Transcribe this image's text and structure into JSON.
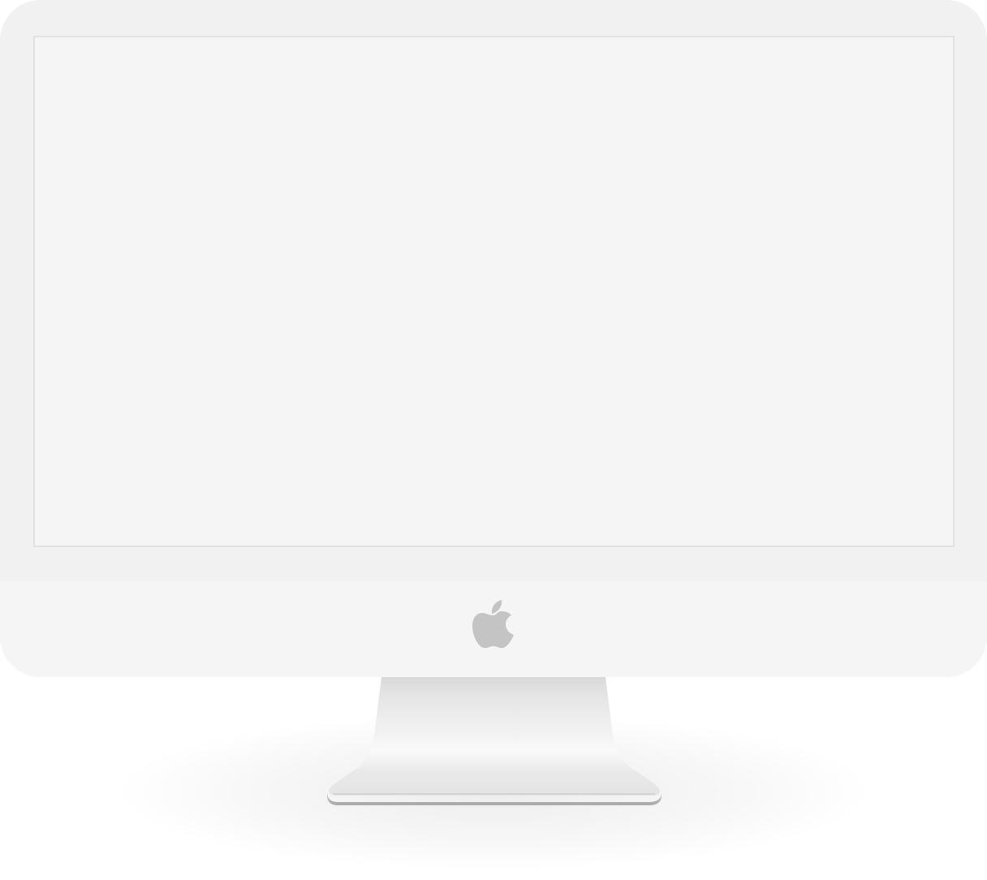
{
  "device": {
    "type": "desktop-monitor",
    "logo_icon": "apple-logo-icon",
    "screen_state": "blank"
  },
  "colors": {
    "bezel": "#f1f1f1",
    "screen": "#f5f5f5",
    "screen_border": "#e1e1e1",
    "chin": "#f5f5f5",
    "logo": "#c4c4c4",
    "stand": "#ebebeb",
    "base_edge": "#b9b9b9"
  }
}
